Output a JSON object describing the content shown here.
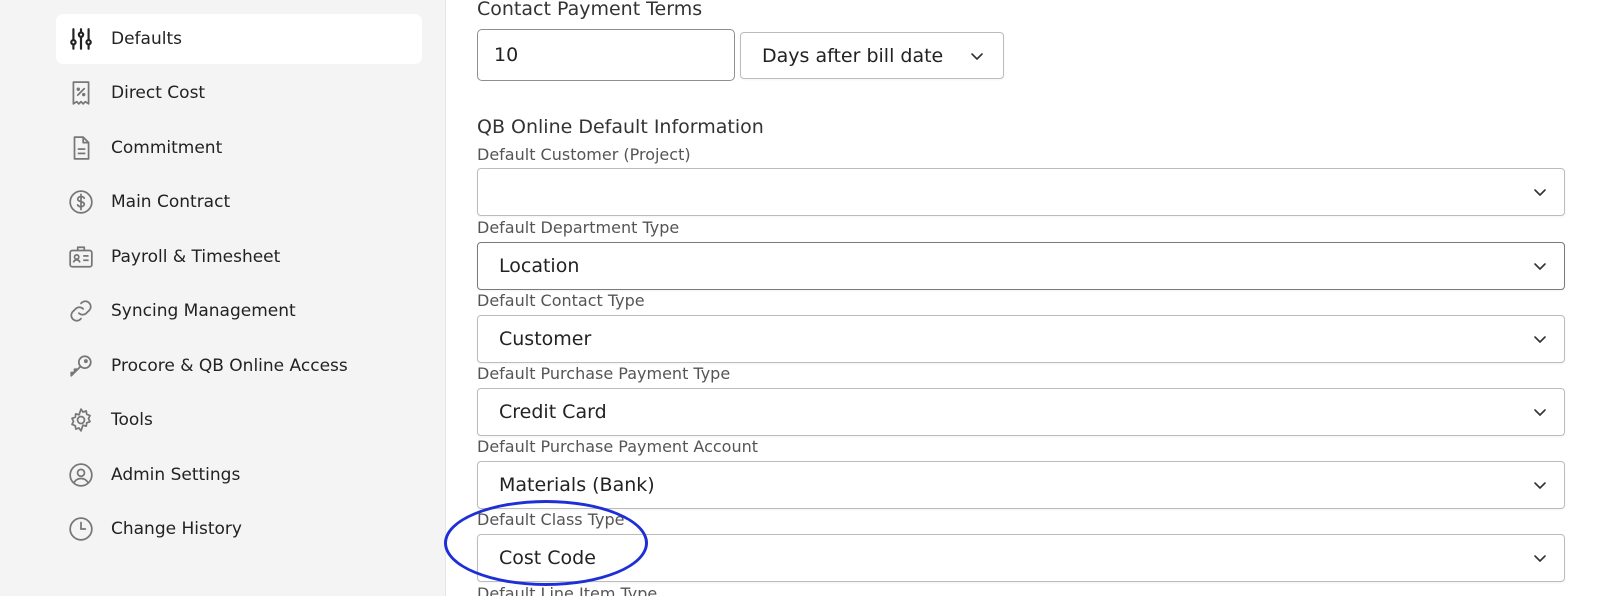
{
  "sidebar": {
    "items": [
      {
        "label": "Defaults",
        "icon": "sliders-icon",
        "active": true
      },
      {
        "label": "Direct Cost",
        "icon": "receipt-icon"
      },
      {
        "label": "Commitment",
        "icon": "document-icon"
      },
      {
        "label": "Main Contract",
        "icon": "dollar-icon"
      },
      {
        "label": "Payroll & Timesheet",
        "icon": "id-card-icon"
      },
      {
        "label": "Syncing Management",
        "icon": "link-icon"
      },
      {
        "label": "Procore & QB Online Access",
        "icon": "key-icon"
      },
      {
        "label": "Tools",
        "icon": "gear-icon"
      },
      {
        "label": "Admin Settings",
        "icon": "user-circle-icon"
      },
      {
        "label": "Change History",
        "icon": "clock-icon"
      }
    ]
  },
  "payment_terms": {
    "title": "Contact Payment Terms",
    "days_value": "10",
    "term_select": "Days after bill date"
  },
  "qbo_defaults": {
    "title": "QB Online Default Information",
    "customer": {
      "label": "Default Customer (Project)",
      "value": ""
    },
    "department_type": {
      "label": "Default Department Type",
      "value": "Location"
    },
    "contact_type": {
      "label": "Default Contact Type",
      "value": "Customer"
    },
    "purchase_payment_type": {
      "label": "Default Purchase Payment Type",
      "value": "Credit Card"
    },
    "purchase_payment_account": {
      "label": "Default Purchase Payment Account",
      "value": "Materials (Bank)"
    },
    "class_type": {
      "label": "Default Class Type",
      "value": "Cost Code"
    },
    "line_item_type": {
      "label": "Default Line Item Type"
    }
  },
  "colors": {
    "highlight_ellipse": "#1f2fd6",
    "sidebar_bg": "#f4f4f4"
  }
}
